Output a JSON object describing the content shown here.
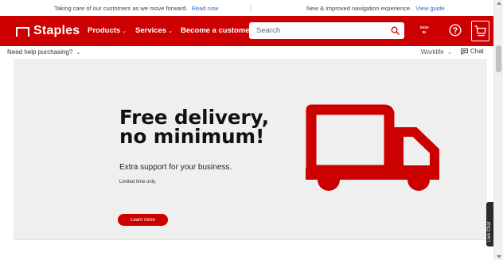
{
  "announcement": {
    "left_text": "Taking care of our customers as we move forward.",
    "left_link": "Read now",
    "separator": "|",
    "right_text": "New & improved navigation experience.",
    "right_link": "View guide"
  },
  "header": {
    "logo": "Staples",
    "nav": {
      "products": "Products",
      "services": "Services",
      "business": "Become a customer"
    },
    "chevron": "⌄",
    "search": {
      "placeholder": "Search"
    },
    "signin": {
      "line1": "SIGN",
      "line2": "IN"
    }
  },
  "subbar": {
    "need_help": "Need help purchasing?",
    "worklife": "Worklife",
    "chat": "Chat"
  },
  "hero": {
    "title_line1": "Free delivery,",
    "title_line2": "no minimum!",
    "subtitle": "Extra support for your business.",
    "note": "Limited time only.",
    "cta": "Learn more"
  },
  "live_chat": {
    "label": "Live Chat"
  },
  "colors": {
    "brand_red": "#cc0000",
    "hero_bg": "#efefef",
    "link_blue": "#2a6bd6"
  },
  "icons": [
    "staples-logo-icon",
    "search-icon",
    "help-icon",
    "cart-icon",
    "chat-icon",
    "truck-icon",
    "chevron-down-icon"
  ]
}
